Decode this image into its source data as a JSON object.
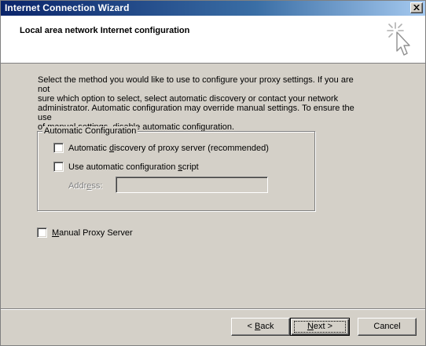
{
  "window": {
    "title": "Internet Connection Wizard"
  },
  "header": {
    "title": "Local area network Internet configuration",
    "icon": "wizard-cursor-icon"
  },
  "intro": "Select the method you would like to use to configure your proxy settings.  If you are not\nsure which option to select, select automatic discovery or contact your network\nadministrator.  Automatic configuration may override manual settings.  To ensure the use\nof manual settings, disable automatic configuration.",
  "auto_config": {
    "legend": "Automatic Configuration",
    "discovery": {
      "label_pre": "Automatic ",
      "label_accel": "d",
      "label_post": "iscovery of proxy server (recommended)",
      "checked": false
    },
    "script": {
      "label_pre": "Use automatic configuration ",
      "label_accel": "s",
      "label_post": "cript",
      "checked": false
    },
    "address": {
      "label_pre": "Addr",
      "label_accel": "e",
      "label_post": "ss:",
      "value": ""
    }
  },
  "manual": {
    "label_pre": "",
    "label_accel": "M",
    "label_post": "anual Proxy Server",
    "checked": false
  },
  "buttons": {
    "back": {
      "pre": "< ",
      "accel": "B",
      "post": "ack"
    },
    "next": {
      "pre": "",
      "accel": "N",
      "post": "ext >"
    },
    "cancel": {
      "label": "Cancel"
    }
  }
}
